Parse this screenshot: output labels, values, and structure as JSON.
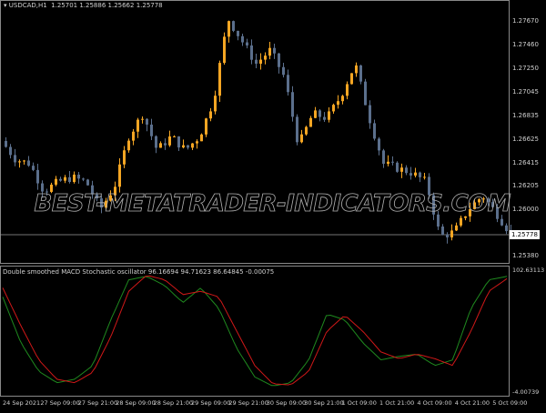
{
  "main": {
    "title": "USDCAD,H1",
    "ohlc": "1.25701 1.25886 1.25662 1.25778",
    "current_price": "1.25778",
    "watermark": "BEST-METATRADER-INDICATORS.COM"
  },
  "indicator": {
    "title": "Double smoothed MACD Stochastic oscillator 96.16694 94.71623 86.64845 -0.00075",
    "scale_max": "102.63113",
    "scale_min": "-4.00739"
  },
  "colors": {
    "bull": "#f5a623",
    "bear": "#5b6f8c",
    "signal_green": "#1f8a1f",
    "signal_red": "#d01818",
    "grid": "#888888"
  },
  "chart_data": {
    "type": "candlestick",
    "price_axis_labels": [
      "1.27670",
      "1.27460",
      "1.27250",
      "1.27045",
      "1.26835",
      "1.26625",
      "1.26415",
      "1.26205",
      "1.26000",
      "1.25380"
    ],
    "time_labels": [
      "24 Sep 2021",
      "27 Sep 09:00",
      "27 Sep 21:00",
      "28 Sep 09:00",
      "28 Sep 21:00",
      "29 Sep 09:00",
      "29 Sep 21:00",
      "30 Sep 09:00",
      "30 Sep 21:00",
      "1 Oct 09:00",
      "1 Oct 21:00",
      "4 Oct 09:00",
      "4 Oct 21:00",
      "5 Oct 09:00"
    ],
    "price_keypoints": [
      1.26613,
      1.26449,
      1.26409,
      1.26163,
      1.26245,
      1.26286,
      1.26245,
      1.26,
      1.26204,
      1.26654,
      1.26858,
      1.26531,
      1.26654,
      1.26531,
      1.26654,
      1.2698,
      1.27716,
      1.27511,
      1.27307,
      1.2743,
      1.27185,
      1.26572,
      1.26858,
      1.26817,
      1.27021,
      1.27307,
      1.26817,
      1.26409,
      1.26368,
      1.26327,
      1.26245,
      1.25755,
      1.25796,
      1.26,
      1.26123,
      1.25959,
      1.25778
    ],
    "oscillator_green": [
      80,
      40,
      15,
      5,
      8,
      20,
      60,
      95,
      98,
      90,
      75,
      88,
      70,
      35,
      10,
      2,
      5,
      25,
      65,
      60,
      40,
      25,
      28,
      30,
      20,
      25,
      70,
      95,
      98
    ],
    "oscillator_red": [
      88,
      55,
      25,
      8,
      5,
      14,
      45,
      85,
      99,
      95,
      82,
      85,
      80,
      50,
      20,
      4,
      3,
      15,
      50,
      64,
      50,
      32,
      26,
      30,
      26,
      20,
      50,
      85,
      96
    ]
  }
}
